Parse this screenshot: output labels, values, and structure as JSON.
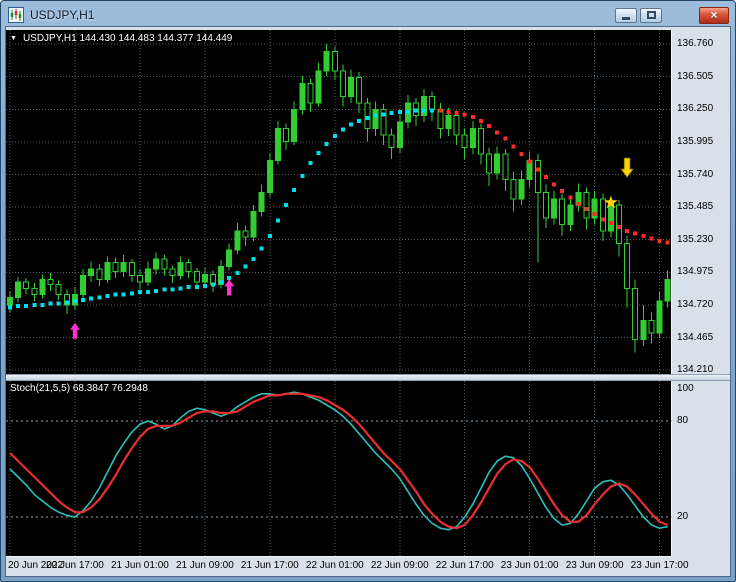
{
  "window": {
    "title": "USDJPY,H1",
    "icons": {
      "app": "candlestick-chart-icon",
      "minimize": "minimize-icon",
      "maximize": "maximize-icon",
      "close": "close-icon",
      "close_glyph": "×",
      "quote_dropdown_glyph": "▼"
    }
  },
  "main_chart": {
    "ohlc_label": {
      "arrow": "▼",
      "text": "USDJPY,H1 144.430 144.483 144.377 144.449"
    },
    "price_axis_labels": [
      "136.760",
      "136.505",
      "136.250",
      "135.995",
      "135.740",
      "135.485",
      "135.230",
      "134.975",
      "134.720",
      "134.465",
      "134.210"
    ]
  },
  "stoch_panel": {
    "label": "Stoch(21,5,5) 68.3847 76.2948",
    "axis_labels": [
      "100",
      "80",
      "20"
    ]
  },
  "time_axis_labels": [
    "20 Jun 2022",
    "20 Jun 17:00",
    "21 Jun 01:00",
    "21 Jun 09:00",
    "21 Jun 17:00",
    "22 Jun 01:00",
    "22 Jun 09:00",
    "22 Jun 17:00",
    "23 Jun 01:00",
    "23 Jun 09:00",
    "23 Jun 17:00"
  ],
  "colors": {
    "chart_bg": "#000000",
    "grid": "#4a5a68",
    "level": "#93a4b4",
    "candle_outline": "#33cc33",
    "candle_bull": "#33cc33",
    "candle_bear": "#000000",
    "trend_up": "#00dfe8",
    "trend_down": "#ff2a2a",
    "arrow_buy": "#ff2fd0",
    "arrow_sell": "#ffd400",
    "star": "#ffd400",
    "stoch_main": "#2fc0bb",
    "stoch_signal": "#e92f2f",
    "axis_text": "#000000"
  },
  "chart_data": {
    "type": "candlestick",
    "symbol": "USDJPY",
    "timeframe": "H1",
    "ylim": [
      134.18,
      136.87
    ],
    "candles": [
      [
        134.72,
        134.83,
        134.66,
        134.78
      ],
      [
        134.78,
        134.94,
        134.74,
        134.9
      ],
      [
        134.9,
        134.93,
        134.8,
        134.85
      ],
      [
        134.85,
        134.89,
        134.75,
        134.8
      ],
      [
        134.8,
        134.96,
        134.77,
        134.92
      ],
      [
        134.92,
        134.97,
        134.83,
        134.88
      ],
      [
        134.88,
        134.91,
        134.76,
        134.8
      ],
      [
        134.8,
        134.84,
        134.65,
        134.72
      ],
      [
        134.72,
        134.86,
        134.68,
        134.8
      ],
      [
        134.8,
        135.0,
        134.77,
        134.95
      ],
      [
        134.95,
        135.06,
        134.9,
        135.0
      ],
      [
        135.0,
        135.04,
        134.87,
        134.92
      ],
      [
        134.92,
        135.1,
        134.89,
        135.05
      ],
      [
        135.05,
        135.09,
        134.93,
        134.98
      ],
      [
        134.98,
        135.11,
        134.94,
        135.05
      ],
      [
        135.05,
        135.08,
        134.9,
        134.95
      ],
      [
        134.95,
        135.0,
        134.84,
        134.9
      ],
      [
        134.9,
        135.06,
        134.87,
        135.0
      ],
      [
        135.0,
        135.13,
        134.96,
        135.08
      ],
      [
        135.08,
        135.11,
        134.95,
        135.0
      ],
      [
        135.0,
        135.03,
        134.89,
        134.95
      ],
      [
        134.95,
        135.1,
        134.92,
        135.05
      ],
      [
        135.05,
        135.08,
        134.93,
        134.98
      ],
      [
        134.98,
        135.01,
        134.85,
        134.9
      ],
      [
        134.9,
        135.01,
        134.86,
        134.96
      ],
      [
        134.96,
        134.99,
        134.82,
        134.88
      ],
      [
        134.88,
        135.07,
        134.85,
        135.02
      ],
      [
        135.02,
        135.2,
        134.99,
        135.15
      ],
      [
        135.15,
        135.36,
        135.12,
        135.3
      ],
      [
        135.3,
        135.34,
        135.18,
        135.25
      ],
      [
        135.25,
        135.5,
        135.22,
        135.45
      ],
      [
        135.45,
        135.66,
        135.41,
        135.6
      ],
      [
        135.6,
        135.91,
        135.56,
        135.85
      ],
      [
        135.85,
        136.16,
        135.82,
        136.1
      ],
      [
        136.1,
        136.14,
        135.93,
        136.0
      ],
      [
        136.0,
        136.31,
        135.97,
        136.25
      ],
      [
        136.25,
        136.51,
        136.21,
        136.45
      ],
      [
        136.45,
        136.49,
        136.23,
        136.3
      ],
      [
        136.3,
        136.61,
        136.27,
        136.55
      ],
      [
        136.55,
        136.76,
        136.51,
        136.7
      ],
      [
        136.7,
        136.74,
        136.48,
        136.55
      ],
      [
        136.55,
        136.6,
        136.27,
        136.35
      ],
      [
        136.35,
        136.56,
        136.3,
        136.5
      ],
      [
        136.5,
        136.54,
        136.22,
        136.3
      ],
      [
        136.3,
        136.34,
        136.0,
        136.1
      ],
      [
        136.1,
        136.31,
        136.04,
        136.25
      ],
      [
        136.25,
        136.29,
        135.97,
        136.05
      ],
      [
        136.05,
        136.1,
        135.86,
        135.95
      ],
      [
        135.95,
        136.21,
        135.91,
        136.15
      ],
      [
        136.15,
        136.36,
        136.1,
        136.3
      ],
      [
        136.3,
        136.34,
        136.12,
        136.2
      ],
      [
        136.2,
        136.41,
        136.15,
        136.35
      ],
      [
        136.35,
        136.39,
        136.16,
        136.25
      ],
      [
        136.25,
        136.3,
        136.02,
        136.1
      ],
      [
        136.1,
        136.26,
        136.04,
        136.2
      ],
      [
        136.2,
        136.24,
        135.97,
        136.05
      ],
      [
        136.05,
        136.1,
        135.86,
        135.95
      ],
      [
        135.95,
        136.16,
        135.9,
        136.1
      ],
      [
        136.1,
        136.14,
        135.82,
        135.9
      ],
      [
        135.9,
        135.95,
        135.65,
        135.75
      ],
      [
        135.75,
        135.96,
        135.7,
        135.9
      ],
      [
        135.9,
        135.94,
        135.61,
        135.7
      ],
      [
        135.7,
        135.76,
        135.45,
        135.55
      ],
      [
        135.55,
        135.77,
        135.5,
        135.7
      ],
      [
        135.7,
        135.92,
        135.64,
        135.85
      ],
      [
        135.85,
        135.9,
        135.05,
        135.6
      ],
      [
        135.6,
        135.66,
        135.32,
        135.4
      ],
      [
        135.4,
        135.61,
        135.35,
        135.55
      ],
      [
        135.55,
        135.59,
        135.26,
        135.35
      ],
      [
        135.35,
        135.56,
        135.3,
        135.5
      ],
      [
        135.5,
        135.67,
        135.45,
        135.6
      ],
      [
        135.6,
        135.64,
        135.31,
        135.4
      ],
      [
        135.4,
        135.61,
        135.35,
        135.55
      ],
      [
        135.55,
        135.59,
        135.22,
        135.3
      ],
      [
        135.3,
        135.56,
        135.25,
        135.5
      ],
      [
        135.5,
        135.54,
        135.1,
        135.2
      ],
      [
        135.2,
        135.26,
        134.7,
        134.85
      ],
      [
        134.85,
        134.92,
        134.35,
        134.45
      ],
      [
        134.45,
        134.72,
        134.4,
        134.6
      ],
      [
        134.6,
        134.66,
        134.42,
        134.5
      ],
      [
        134.5,
        134.82,
        134.46,
        134.75
      ],
      [
        134.75,
        134.99,
        134.7,
        134.92
      ]
    ],
    "trend_dots": {
      "up_until_index": 52,
      "values": [
        134.7,
        134.71,
        134.71,
        134.72,
        134.72,
        134.73,
        134.73,
        134.74,
        134.75,
        134.76,
        134.77,
        134.78,
        134.79,
        134.8,
        134.8,
        134.81,
        134.82,
        134.82,
        134.83,
        134.84,
        134.84,
        134.85,
        134.86,
        134.86,
        134.87,
        134.88,
        134.9,
        134.93,
        134.97,
        135.02,
        135.08,
        135.16,
        135.26,
        135.38,
        135.5,
        135.62,
        135.73,
        135.83,
        135.91,
        135.98,
        136.04,
        136.09,
        136.13,
        136.16,
        136.18,
        136.2,
        136.21,
        136.22,
        136.23,
        136.23,
        136.24,
        136.24,
        136.24,
        136.24,
        136.23,
        136.22,
        136.21,
        136.19,
        136.16,
        136.12,
        136.07,
        136.02,
        135.96,
        135.9,
        135.84,
        135.78,
        135.72,
        135.66,
        135.61,
        135.56,
        135.51,
        135.47,
        135.43,
        135.39,
        135.36,
        135.33,
        135.3,
        135.28,
        135.26,
        135.24,
        135.22,
        135.21
      ]
    },
    "arrows": [
      {
        "type": "up",
        "bar": 8,
        "price": 134.58,
        "color": "#ff2fd0",
        "name": "buy-arrow-1"
      },
      {
        "type": "up",
        "bar": 27,
        "price": 134.92,
        "color": "#ff2fd0",
        "name": "buy-arrow-2"
      },
      {
        "type": "down",
        "bar": 76,
        "price": 135.72,
        "color": "#ffd400",
        "name": "sell-arrow"
      },
      {
        "type": "star",
        "bar": 74,
        "price": 135.52,
        "color": "#ffd400",
        "name": "signal-star"
      }
    ],
    "stochastic": {
      "indicator": "Stoch(21,5,5)",
      "values_label": [
        68.3847,
        76.2948
      ],
      "ylim": [
        -5,
        105
      ],
      "levels": [
        80,
        20
      ],
      "main": [
        50,
        45,
        40,
        34,
        30,
        26,
        23,
        21,
        20,
        24,
        30,
        38,
        48,
        58,
        66,
        73,
        78,
        80,
        78,
        75,
        77,
        82,
        86,
        88,
        87,
        85,
        83,
        85,
        89,
        92,
        95,
        97,
        97,
        96,
        97,
        98,
        97,
        95,
        93,
        90,
        87,
        83,
        78,
        72,
        66,
        60,
        55,
        50,
        44,
        36,
        28,
        21,
        16,
        13,
        12,
        14,
        20,
        28,
        38,
        48,
        55,
        58,
        57,
        52,
        44,
        35,
        26,
        19,
        15,
        16,
        22,
        30,
        38,
        42,
        43,
        40,
        34,
        27,
        20,
        15,
        13,
        14
      ],
      "signal": [
        60,
        55,
        50,
        45,
        40,
        35,
        30,
        26,
        23,
        23,
        26,
        31,
        38,
        46,
        55,
        63,
        70,
        75,
        77,
        77,
        77,
        79,
        82,
        85,
        86,
        86,
        85,
        85,
        86,
        89,
        92,
        94,
        96,
        96,
        97,
        97,
        97,
        96,
        95,
        93,
        90,
        87,
        83,
        78,
        72,
        66,
        60,
        55,
        50,
        43,
        36,
        28,
        22,
        17,
        14,
        13,
        15,
        21,
        29,
        38,
        47,
        53,
        56,
        55,
        51,
        44,
        36,
        28,
        21,
        17,
        17,
        21,
        28,
        34,
        39,
        41,
        39,
        34,
        28,
        22,
        17,
        15
      ]
    }
  }
}
